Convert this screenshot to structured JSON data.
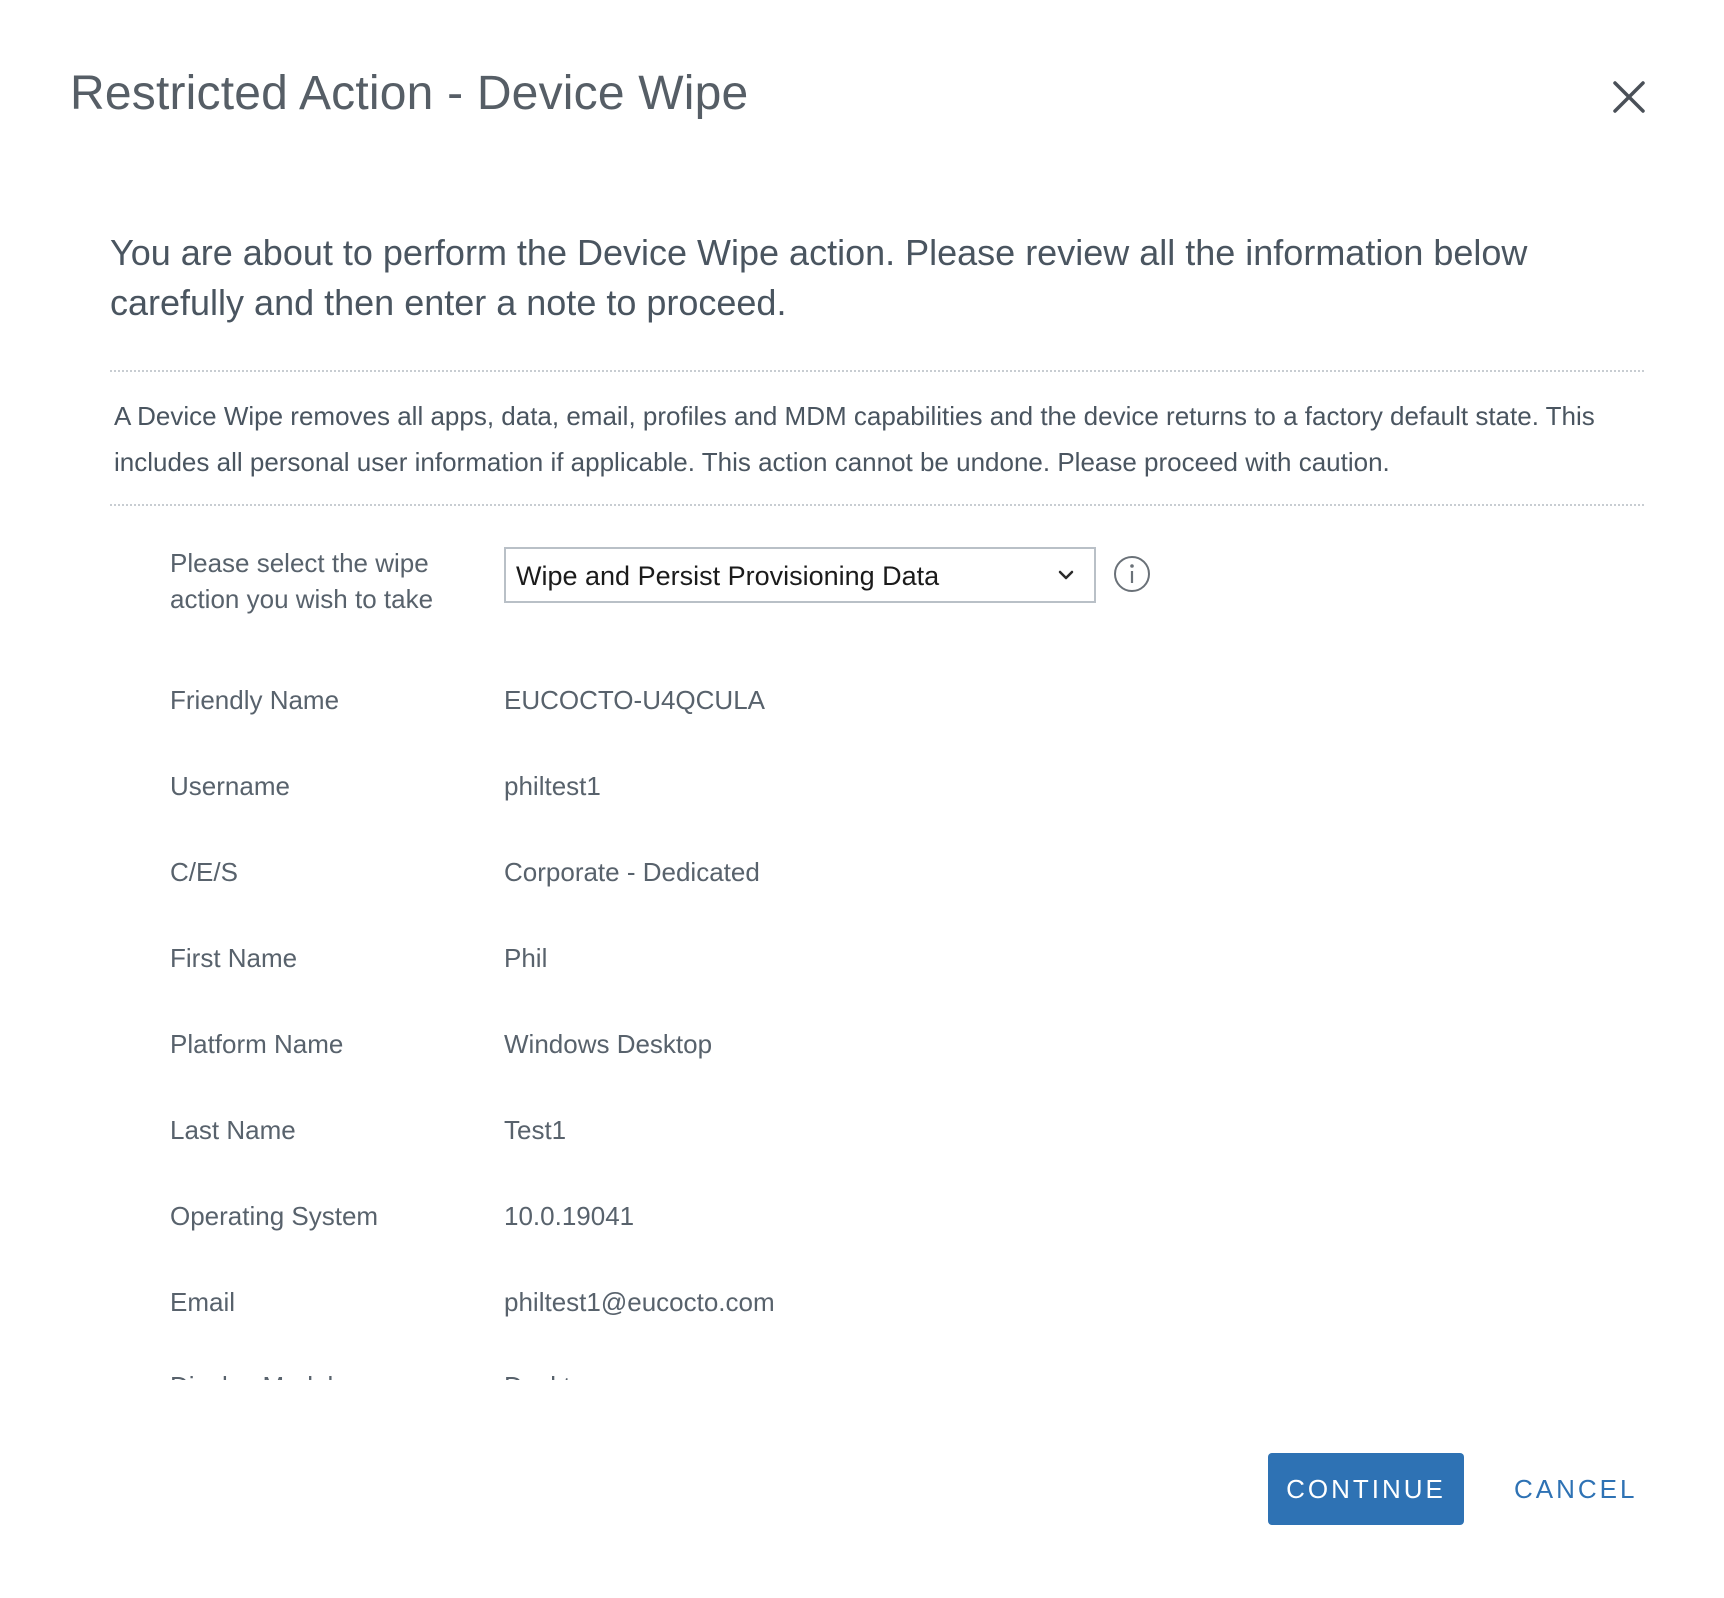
{
  "dialog": {
    "title": "Restricted Action - Device Wipe",
    "close_icon": "close-icon",
    "intro": "You are about to perform the Device Wipe action. Please review all the information below carefully and then enter a note to proceed.",
    "warning": "A Device Wipe removes all apps, data, email, profiles and MDM capabilities and the device returns to a factory default state. This includes all personal user information if applicable. This action cannot be undone. Please proceed with caution."
  },
  "wipe_select": {
    "label": "Please select the wipe action you wish to take",
    "value": "Wipe and Persist Provisioning Data",
    "chevron_icon": "chevron-down-icon",
    "info_icon": "info-icon"
  },
  "fields": [
    {
      "label": "Friendly Name",
      "value": "EUCOCTO-U4QCULA"
    },
    {
      "label": "Username",
      "value": "philtest1"
    },
    {
      "label": "C/E/S",
      "value": "Corporate - Dedicated"
    },
    {
      "label": "First Name",
      "value": "Phil"
    },
    {
      "label": "Platform Name",
      "value": "Windows Desktop"
    },
    {
      "label": "Last Name",
      "value": "Test1"
    },
    {
      "label": "Operating System",
      "value": "10.0.19041"
    },
    {
      "label": "Email",
      "value": "philtest1@eucocto.com"
    },
    {
      "label": "Display Model",
      "value": "Desktop"
    }
  ],
  "footer": {
    "continue_label": "CONTINUE",
    "cancel_label": "CANCEL"
  },
  "colors": {
    "primary": "#2e72b4",
    "text": "#4a5560",
    "divider": "#c8cdd2"
  }
}
